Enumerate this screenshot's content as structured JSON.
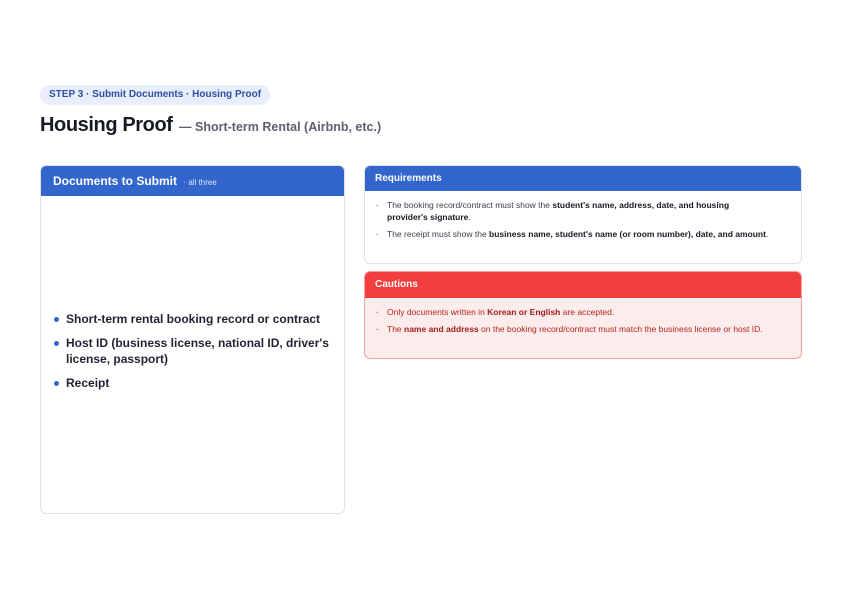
{
  "step_pill": "STEP 3 · Submit Documents · Housing Proof",
  "title": {
    "main": "Housing Proof",
    "sub": "— Short-term Rental (Airbnb, etc.)"
  },
  "documents": {
    "heading": "Documents to Submit",
    "note": "· all three",
    "items": [
      "Short-term rental booking record or contract",
      "Host ID (business license, national ID, driver's license, passport)",
      "Receipt"
    ]
  },
  "requirements": {
    "heading": "Requirements",
    "items": [
      {
        "pre": "The booking record/contract must show the ",
        "bold": "student's name, address, date, and housing provider's signature",
        "post": "."
      },
      {
        "pre": "The receipt must show the ",
        "bold": "business name, student's name (or room number), date, and amount",
        "post": "."
      }
    ]
  },
  "cautions": {
    "heading": "Cautions",
    "items": [
      {
        "pre": "Only documents written in ",
        "bold": "Korean or English",
        "post": " are accepted."
      },
      {
        "pre": "The ",
        "bold": "name and address",
        "post": " on the booking record/contract must match the business license or host ID."
      }
    ]
  },
  "colors": {
    "accent_blue": "#3366cc",
    "caution_red": "#f23e3e",
    "caution_bg": "#fdecec"
  }
}
